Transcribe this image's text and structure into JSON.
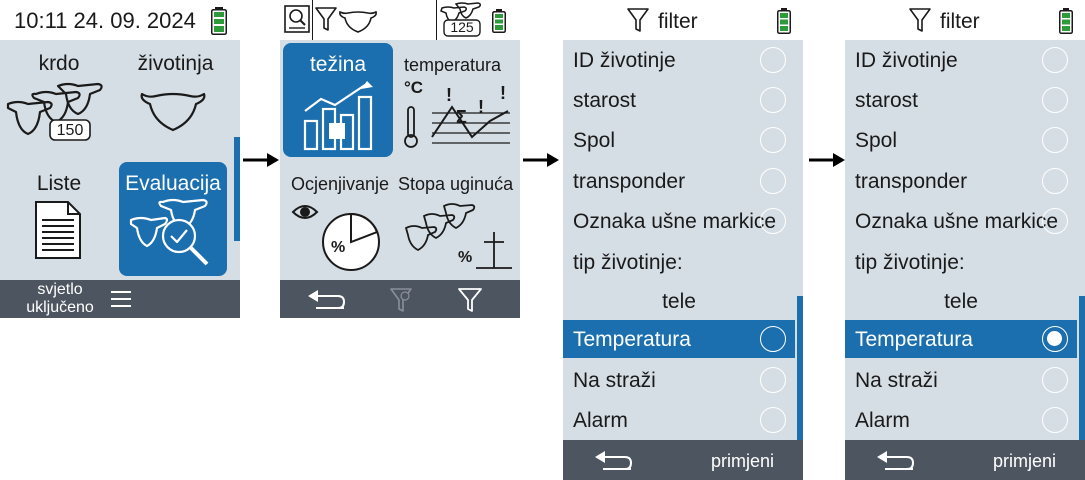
{
  "screen1": {
    "datetime": "10:11 24. 09. 2024",
    "tiles": [
      {
        "label": "krdo",
        "badge": "150"
      },
      {
        "label": "životinja"
      },
      {
        "label": "Liste"
      },
      {
        "label": "Evaluacija"
      }
    ],
    "bottom": {
      "light_line1": "svjetlo",
      "light_line2": "uključeno"
    },
    "icons": [
      "battery-icon",
      "herd-icon",
      "cow-icon",
      "document-icon",
      "evaluation-icon",
      "menu-icon"
    ]
  },
  "screen2": {
    "header_badge": "125",
    "tiles": [
      {
        "label": "težina"
      },
      {
        "label": "temperatura"
      },
      {
        "label": "Ocjenjivanje"
      },
      {
        "label": "Stopa uginuća"
      }
    ],
    "icons": [
      "search-icon",
      "filter-cow-icon",
      "herd-count-icon",
      "battery-icon",
      "back-icon",
      "filter-remove-icon",
      "filter-icon"
    ]
  },
  "screen3": {
    "title": "filter",
    "items": [
      {
        "label": "ID životinje"
      },
      {
        "label": "starost"
      },
      {
        "label": "Spol"
      },
      {
        "label": "transponder"
      },
      {
        "label": "Oznaka ušne markice"
      },
      {
        "label": "tip životinje:"
      },
      {
        "label": "tele"
      },
      {
        "label": "Temperatura"
      },
      {
        "label": "Na straži"
      },
      {
        "label": "Alarm"
      }
    ],
    "apply_label": "primjeni"
  },
  "screen4": {
    "title": "filter",
    "items": [
      {
        "label": "ID životinje"
      },
      {
        "label": "starost"
      },
      {
        "label": "Spol"
      },
      {
        "label": "transponder"
      },
      {
        "label": "Oznaka ušne markice"
      },
      {
        "label": "tip životinje:"
      },
      {
        "label": "tele"
      },
      {
        "label": "Temperatura",
        "checked": true
      },
      {
        "label": "Na straži"
      },
      {
        "label": "Alarm"
      }
    ],
    "apply_label": "primjeni"
  },
  "colors": {
    "accent": "#1c6fae",
    "screen_bg": "#d6dee5",
    "bar_bg": "#4d5560",
    "battery": "#2e9b3a"
  }
}
